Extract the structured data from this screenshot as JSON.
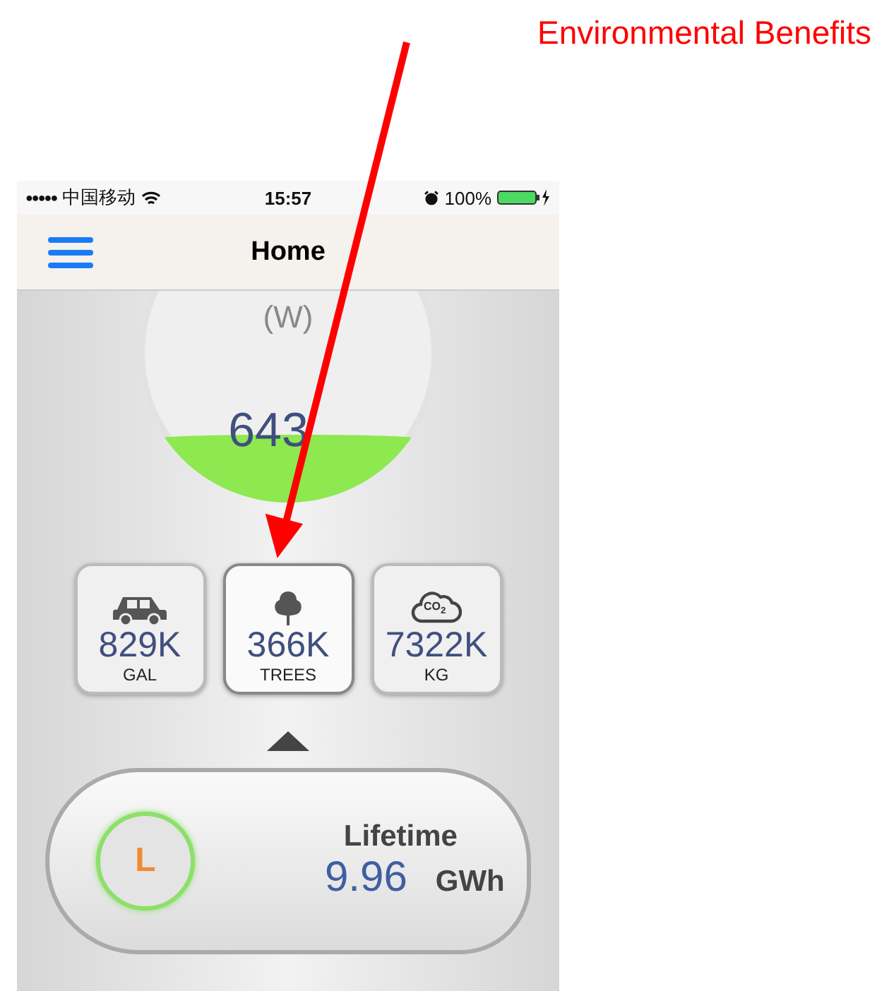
{
  "annotation": {
    "label": "Environmental Benefits"
  },
  "status_bar": {
    "signal": "●●●●●",
    "carrier": "中国移动",
    "time": "15:57",
    "battery": "100%"
  },
  "nav": {
    "title": "Home"
  },
  "gauge": {
    "unit": "(W)",
    "value": "643"
  },
  "benefits": [
    {
      "kind": "car",
      "value": "829K",
      "unit": "GAL",
      "selected": false
    },
    {
      "kind": "tree",
      "value": "366K",
      "unit": "TREES",
      "selected": true
    },
    {
      "kind": "co2",
      "icon_text": "CO$_{2}$",
      "value": "7322K",
      "unit": "KG",
      "selected": false
    }
  ],
  "lifetime": {
    "badge": "L",
    "label": "Lifetime",
    "value": "9.96",
    "unit": "GWh"
  }
}
